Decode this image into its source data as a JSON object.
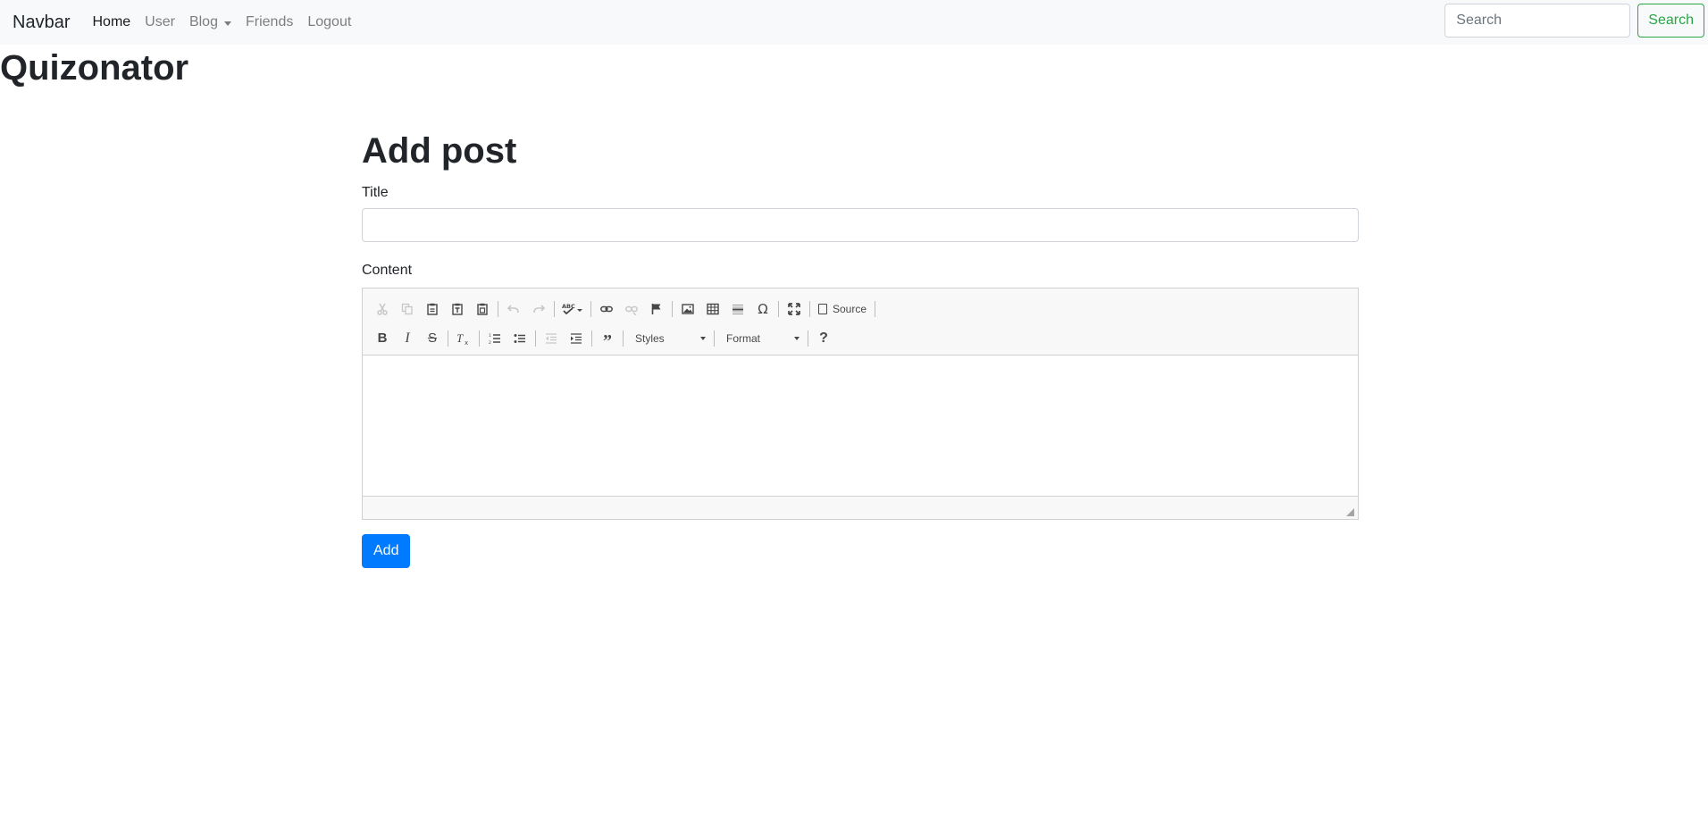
{
  "navbar": {
    "brand": "Navbar",
    "links": [
      {
        "label": "Home",
        "active": true
      },
      {
        "label": "User"
      },
      {
        "label": "Blog"
      },
      {
        "label": "Friends"
      },
      {
        "label": "Logout"
      }
    ],
    "search_placeholder": "Search",
    "search_button": "Search"
  },
  "site_title": "Quizonator",
  "page_title": "Add post",
  "form": {
    "title_label": "Title",
    "title_value": "",
    "content_label": "Content",
    "submit_label": "Add"
  },
  "editor": {
    "source_label": "Source",
    "styles_label": "Styles",
    "format_label": "Format",
    "toolbar_row1_icons": [
      "cut-icon",
      "copy-icon",
      "paste-icon",
      "paste-text-icon",
      "paste-word-icon",
      "undo-icon",
      "redo-icon",
      "spellcheck-icon",
      "link-icon",
      "unlink-icon",
      "anchor-icon",
      "image-icon",
      "table-icon",
      "horizontal-line-icon",
      "special-char-icon",
      "maximize-icon",
      "source-icon"
    ],
    "toolbar_row2_icons": [
      "bold-icon",
      "italic-icon",
      "strike-icon",
      "remove-format-icon",
      "numbered-list-icon",
      "bulleted-list-icon",
      "outdent-icon",
      "indent-icon",
      "blockquote-icon",
      "help-icon"
    ]
  },
  "colors": {
    "primary": "#007bff",
    "success": "#28a745",
    "navbar_bg": "#f8f9fa"
  }
}
